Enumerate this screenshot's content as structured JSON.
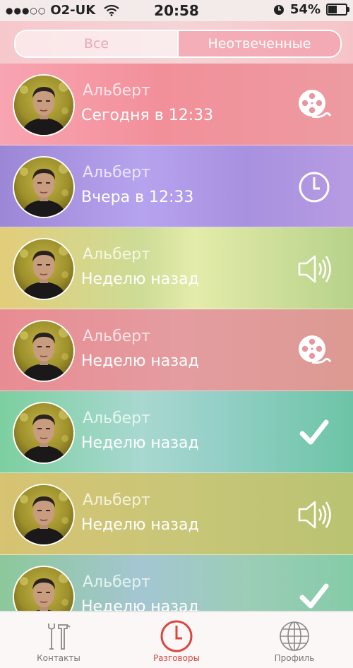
{
  "status_bar": {
    "signal": "●●●○○",
    "carrier": "O2-UK",
    "time": "20:58",
    "battery": "54%"
  },
  "segments": [
    "Все",
    "Неотвеченные"
  ],
  "calls": [
    {
      "name": "Альберт",
      "when": "Сегодня в 12:33",
      "icon": "film-reel-icon",
      "bg": "linear-gradient(90deg,#f9a4b2 0%,#f2909a 45%,#ed9aa0 100%)",
      "name_color": "#fbe6ea"
    },
    {
      "name": "Альберт",
      "when": "Вчера в 12:33",
      "icon": "clock-icon",
      "bg": "linear-gradient(90deg,#9c86d6 0%,#b6a3ee 40%,#a891e0 70%,#b79be2 100%)",
      "name_color": "#ece4ff"
    },
    {
      "name": "Альберт",
      "when": "Неделю назад",
      "icon": "speaker-icon",
      "bg": "linear-gradient(90deg,#e2cd7a 0%,#cddc96 40%,#e4ecaa 55%,#b7d28a 100%)",
      "name_color": "#f6f6e4"
    },
    {
      "name": "Альберт",
      "when": "Неделю назад",
      "icon": "film-reel-icon",
      "bg": "linear-gradient(90deg,#e88c93 0%,#e49ca0 50%,#dc9a92 100%)",
      "name_color": "#fbe3e4"
    },
    {
      "name": "Альберт",
      "when": "Неделю назад",
      "icon": "check-icon",
      "bg": "linear-gradient(90deg,#7ccfa0 0%,#a8d8d0 40%,#96d0c8 60%,#6cc4a6 100%)",
      "name_color": "#e6f6ef"
    },
    {
      "name": "Альберт",
      "when": "Неделю назад",
      "icon": "speaker-icon",
      "bg": "linear-gradient(90deg,#d7c372 0%,#c9c678 50%,#b9c372 100%)",
      "name_color": "#f4f2da"
    },
    {
      "name": "Альберт",
      "when": "Неделю назад",
      "icon": "check-icon",
      "bg": "linear-gradient(90deg,#8cc89a 0%,#a4c6d2 40%,#9ccdb7 70%,#84cca8 100%)",
      "name_color": "#e4f4ee"
    }
  ],
  "tabs": [
    {
      "label": "Контакты",
      "icon": "tools-icon",
      "color": "#888888"
    },
    {
      "label": "Разговоры",
      "icon": "clock-icon",
      "color": "#d9473f"
    },
    {
      "label": "Профиль",
      "icon": "globe-icon",
      "color": "#888888"
    }
  ]
}
